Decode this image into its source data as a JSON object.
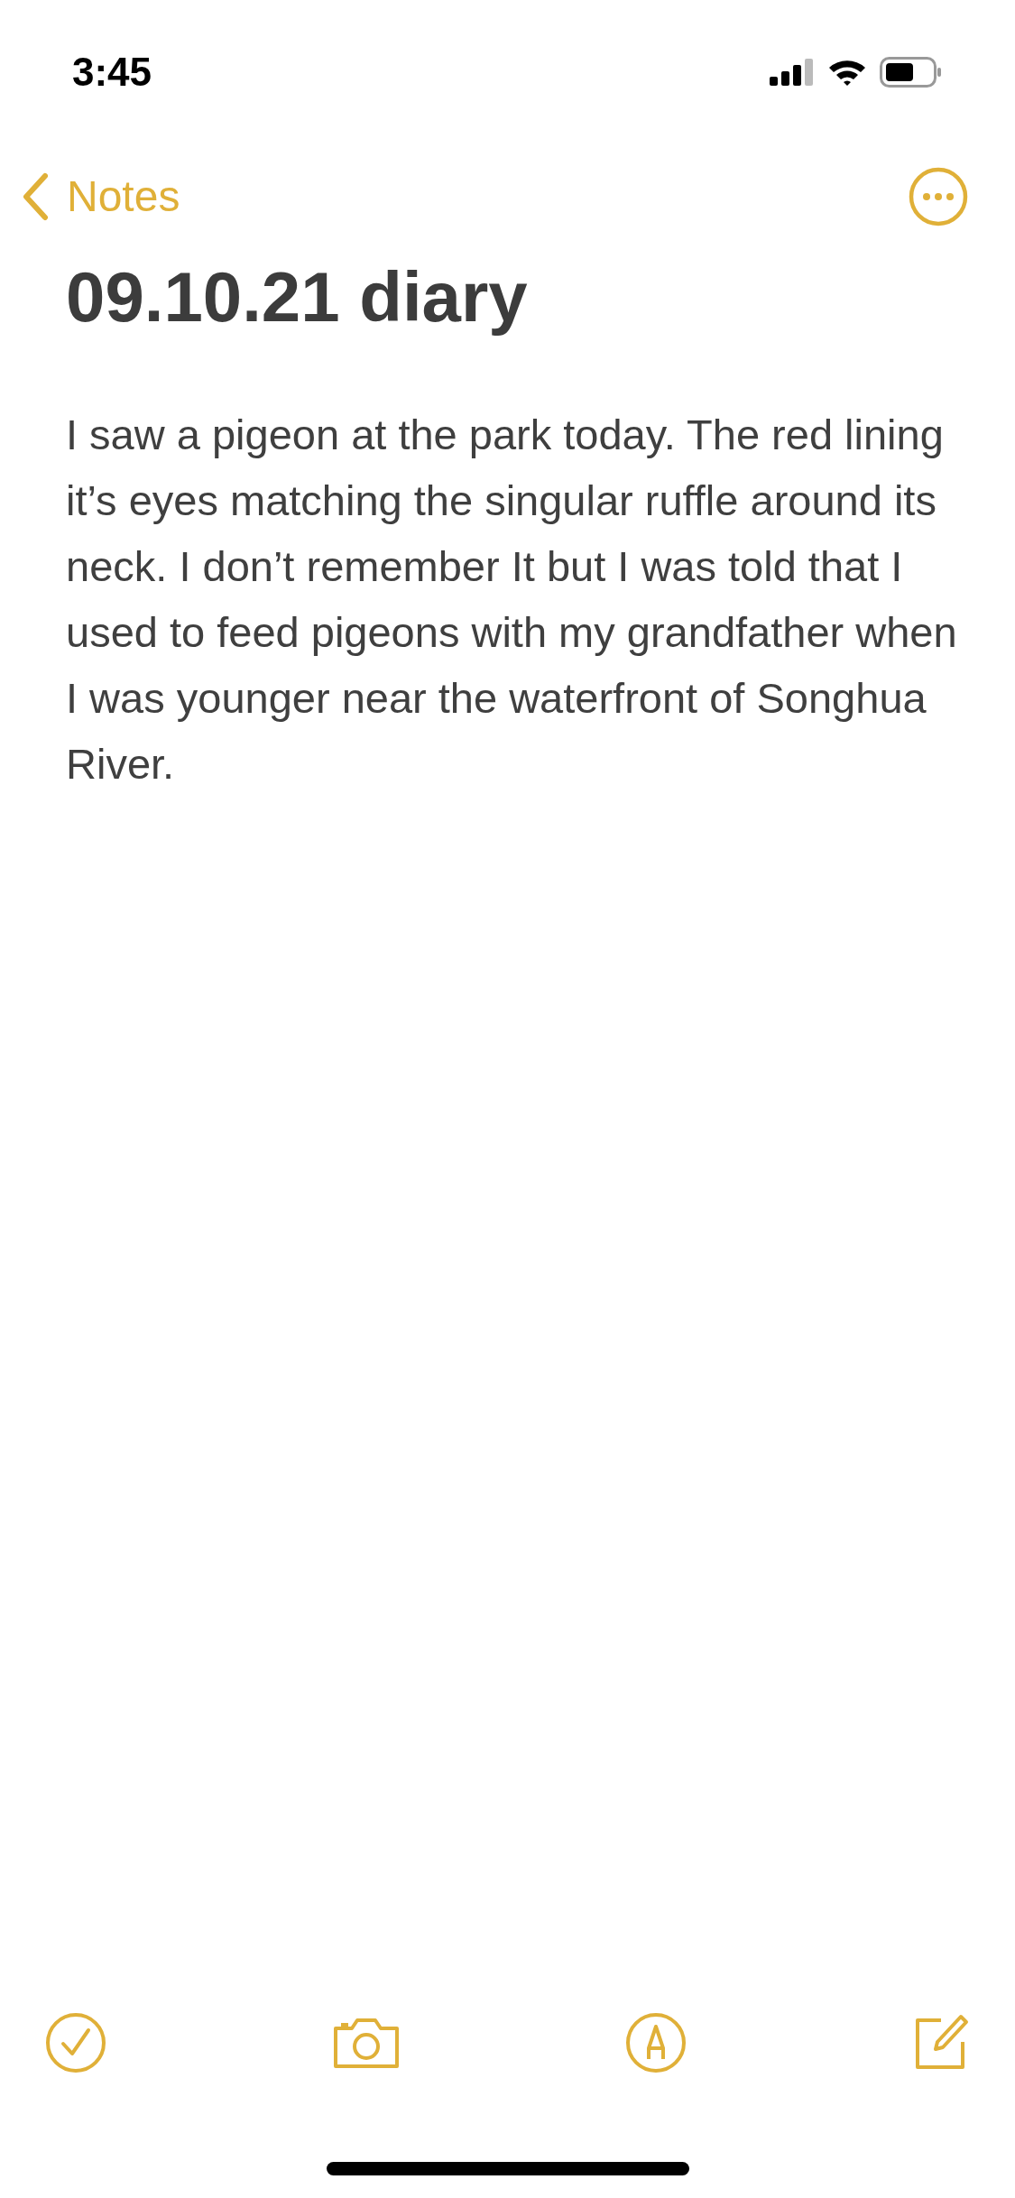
{
  "status_bar": {
    "time": "3:45"
  },
  "nav": {
    "back_label": "Notes"
  },
  "note": {
    "title": "09.10.21 diary",
    "body": "I saw a pigeon at the park today. The red lining it’s eyes matching the singular ruffle around its neck. I don’t remember It but I was told that I used to feed pigeons with my grandfather when I was younger near the waterfront of Songhua River."
  }
}
